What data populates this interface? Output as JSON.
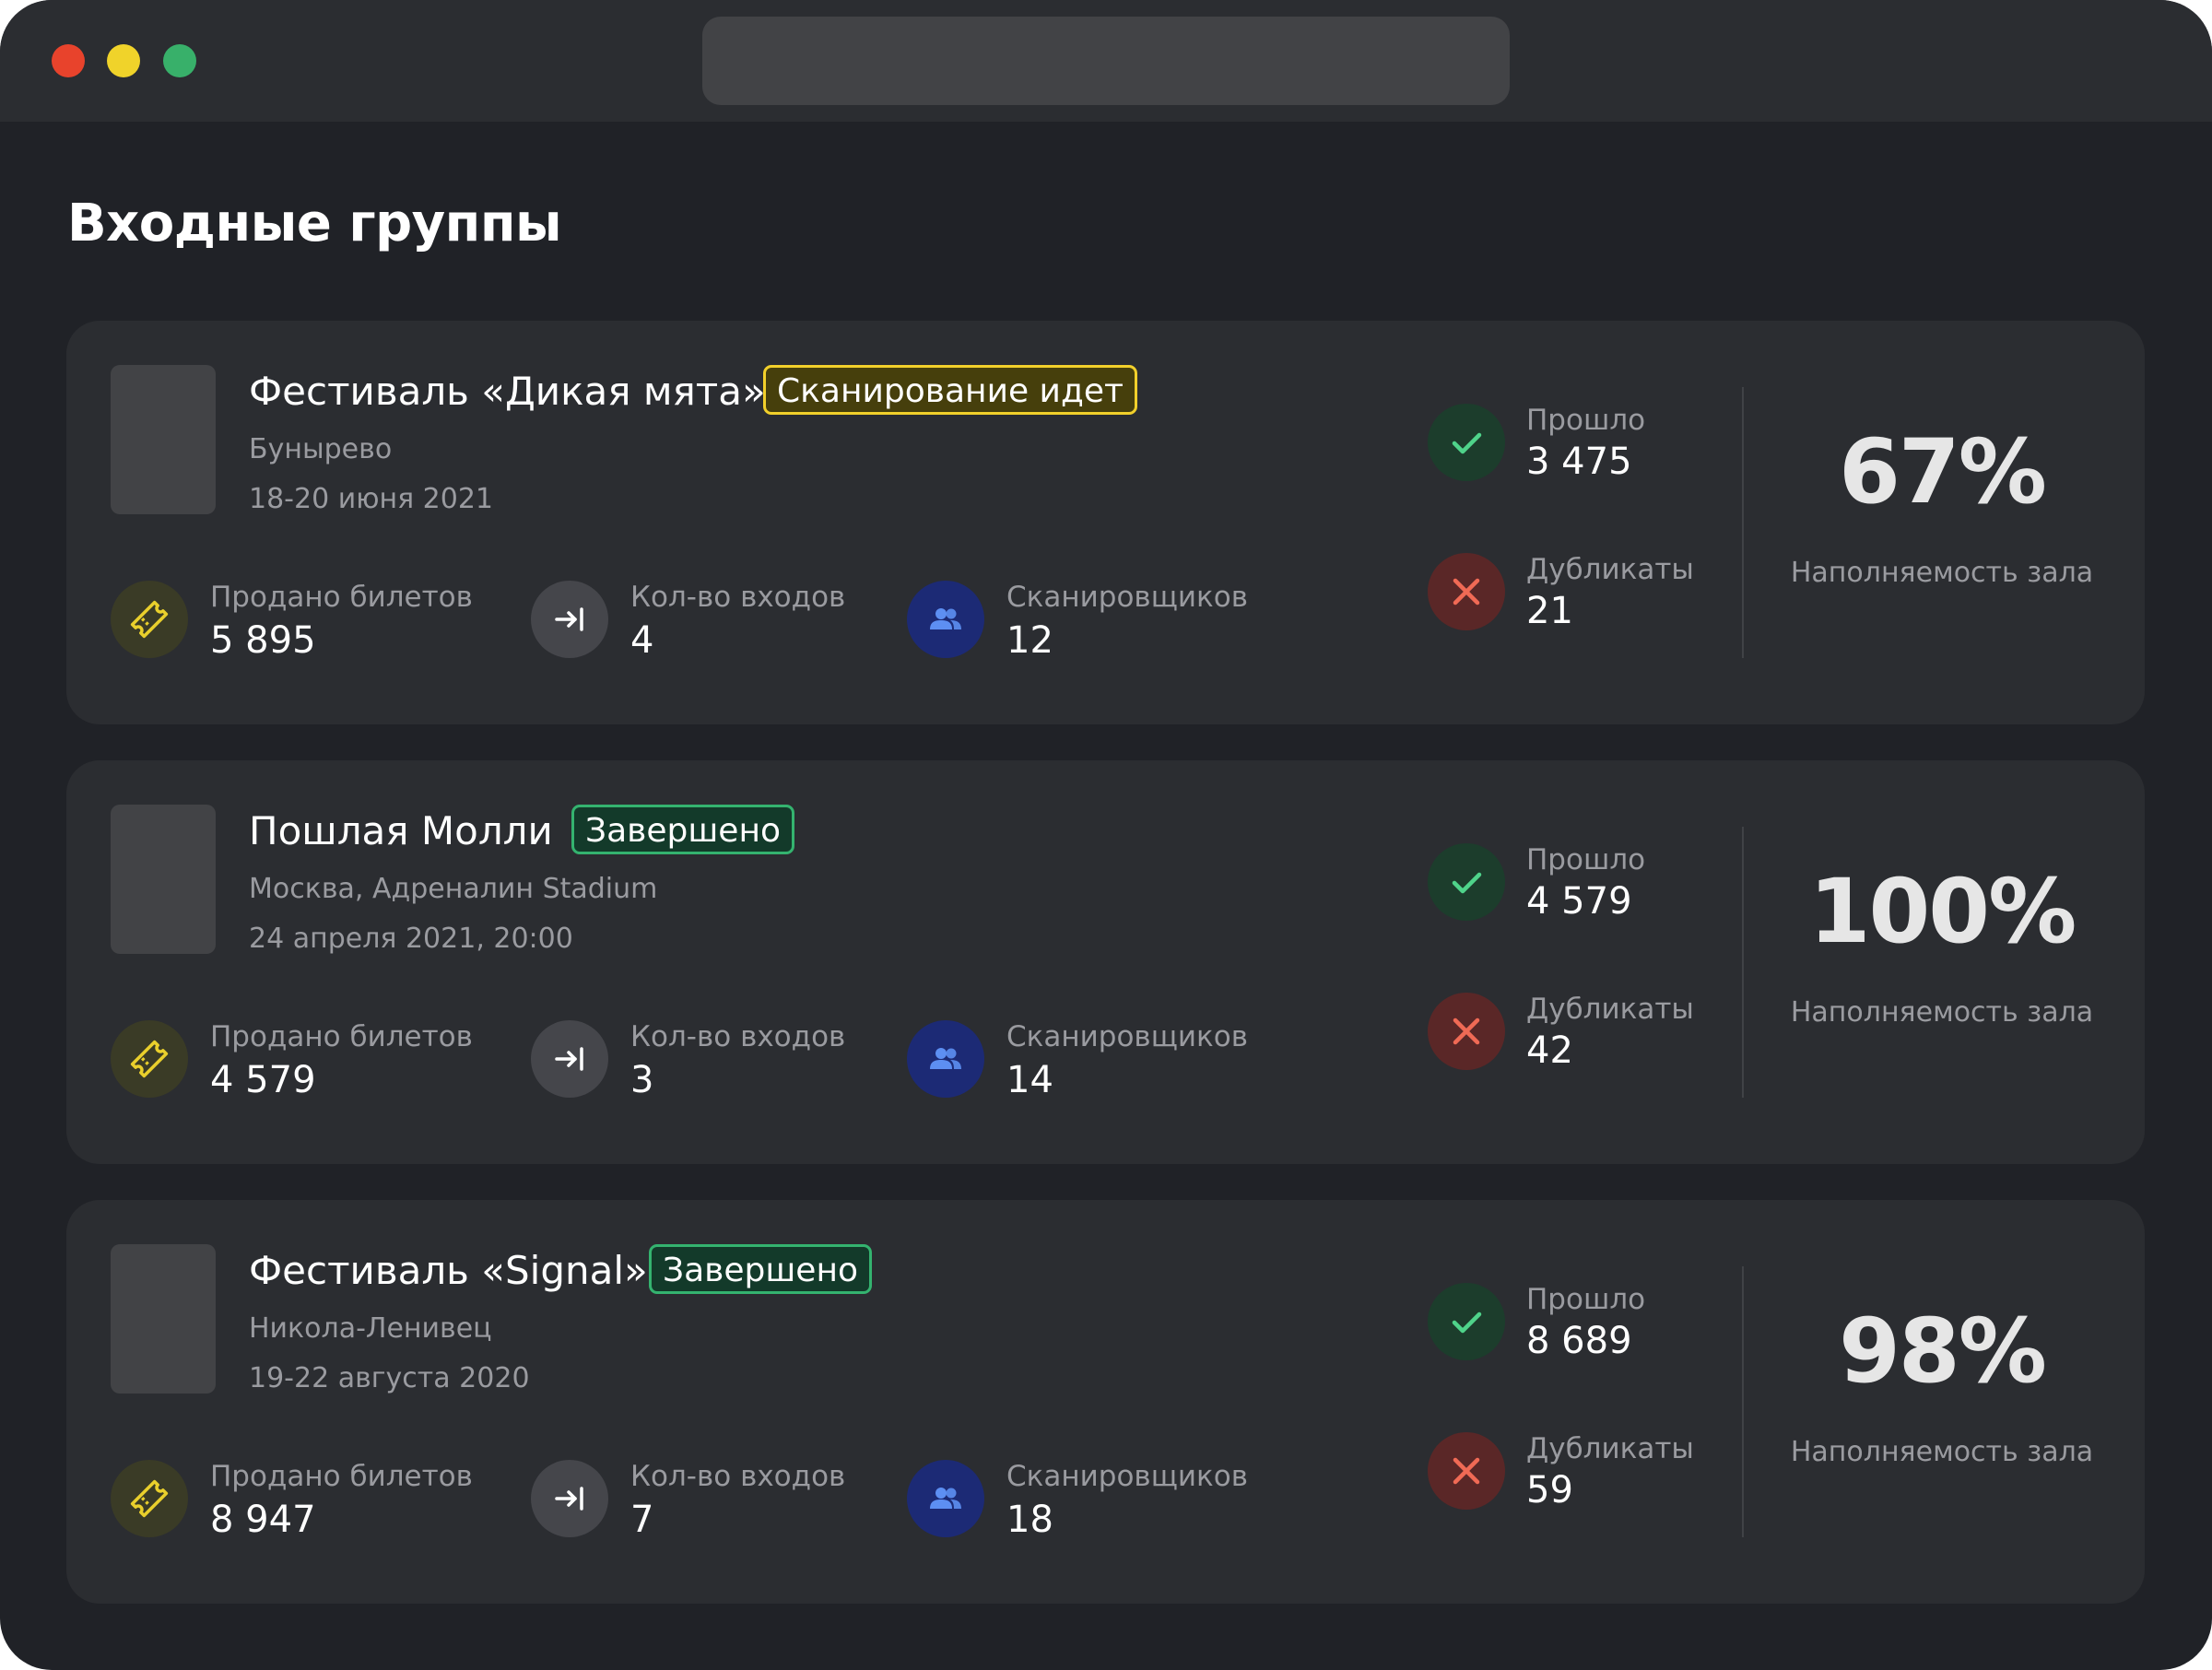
{
  "page": {
    "title": "Входные группы"
  },
  "colors": {
    "window_bg": "#202227",
    "card_bg": "#2b2d31",
    "status_live": "#f2d02b",
    "status_done": "#34b36f",
    "passed": "#4fd38a",
    "duplicate": "#f06a55"
  },
  "labels": {
    "tickets_sold": "Продано билетов",
    "entrances": "Кол-во входов",
    "scanners": "Сканировщиков",
    "passed": "Прошло",
    "duplicates": "Дубликаты",
    "occupancy": "Наполняемость зала"
  },
  "icons": {
    "tickets": "ticket-icon",
    "entrances": "entrance-arrow-icon",
    "scanners": "users-icon",
    "passed": "check-icon",
    "duplicates": "cross-icon"
  },
  "events": [
    {
      "name": "Фестиваль «Дикая мята»",
      "status": "Сканирование идет",
      "status_type": "live",
      "location": "Бунырево",
      "date": "18-20 июня 2021",
      "tickets_sold": "5 895",
      "entrances": "4",
      "scanners": "12",
      "passed": "3 475",
      "duplicates": "21",
      "occupancy": "67%"
    },
    {
      "name": "Пошлая Молли",
      "status": "Завершено",
      "status_type": "done",
      "location": "Москва, Адреналин Stadium",
      "date": "24 апреля 2021, 20:00",
      "tickets_sold": "4 579",
      "entrances": "3",
      "scanners": "14",
      "passed": "4 579",
      "duplicates": "42",
      "occupancy": "100%"
    },
    {
      "name": "Фестиваль «Signal»",
      "status": "Завершено",
      "status_type": "done",
      "location": "Никола-Ленивец",
      "date": "19-22 августа 2020",
      "tickets_sold": "8 947",
      "entrances": "7",
      "scanners": "18",
      "passed": "8 689",
      "duplicates": "59",
      "occupancy": "98%"
    }
  ]
}
